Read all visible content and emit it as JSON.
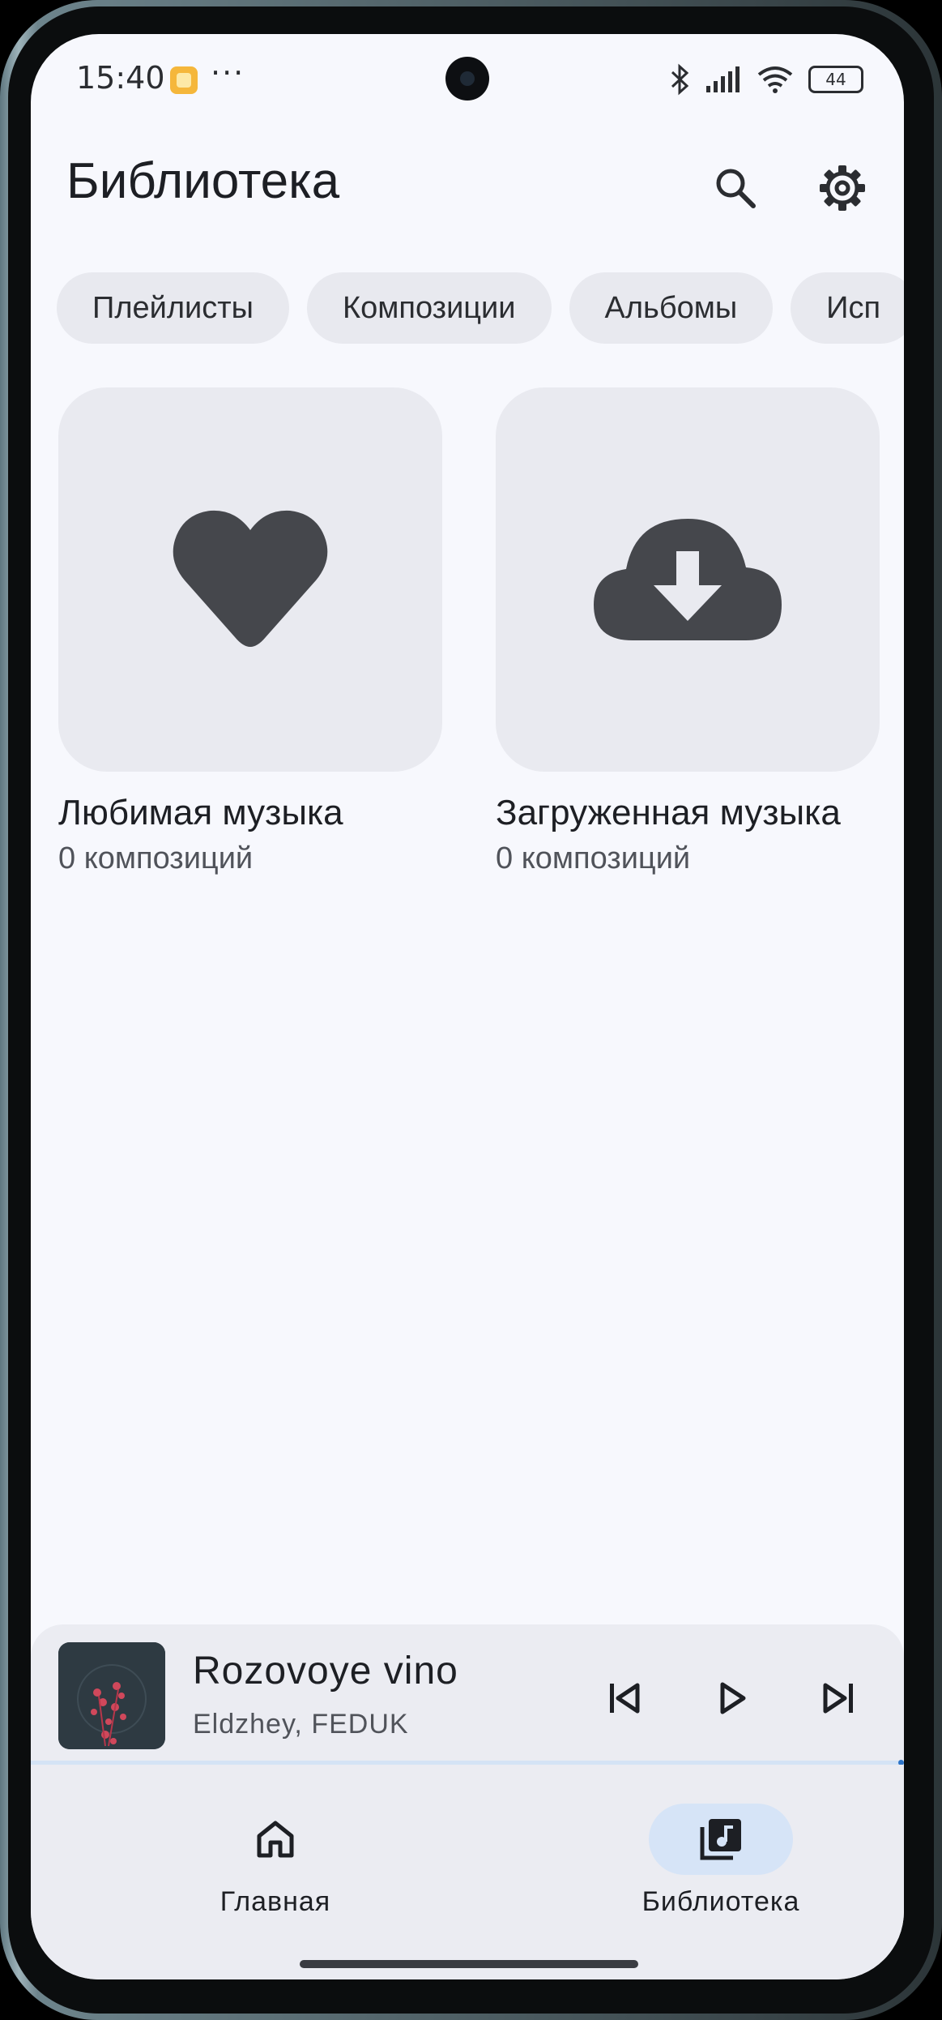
{
  "status_bar": {
    "time": "15:40",
    "dots": "···",
    "battery": "44",
    "icons": [
      "notification-icon",
      "bluetooth-icon",
      "signal-icon",
      "wifi-icon",
      "battery-icon"
    ]
  },
  "header": {
    "title": "Библиотека",
    "icons": [
      "search-icon",
      "settings-gear-icon"
    ]
  },
  "chips": [
    {
      "label": "Плейлисты"
    },
    {
      "label": "Композиции"
    },
    {
      "label": "Альбомы"
    },
    {
      "label": "Исп"
    }
  ],
  "cards": [
    {
      "name": "Любимая музыка",
      "count": "0 композиций",
      "icon": "heart-icon"
    },
    {
      "name": "Загруженная музыка",
      "count": "0 композиций",
      "icon": "cloud-download-icon"
    }
  ],
  "player": {
    "title": "Rozovoye vino",
    "artist": "Eldzhey, FEDUK",
    "controls": [
      "skip-previous-icon",
      "play-icon",
      "skip-next-icon"
    ]
  },
  "nav": [
    {
      "label": "Главная",
      "icon": "home-icon",
      "active": false
    },
    {
      "label": "Библиотека",
      "icon": "library-music-icon",
      "active": true
    }
  ],
  "colors": {
    "background": "#f7f8fd",
    "chip": "#e8e9ef",
    "card": "#e9eaf0",
    "icon": "#45474c",
    "nav_active": "#d6e4f7",
    "progress": "#2d74c8"
  }
}
